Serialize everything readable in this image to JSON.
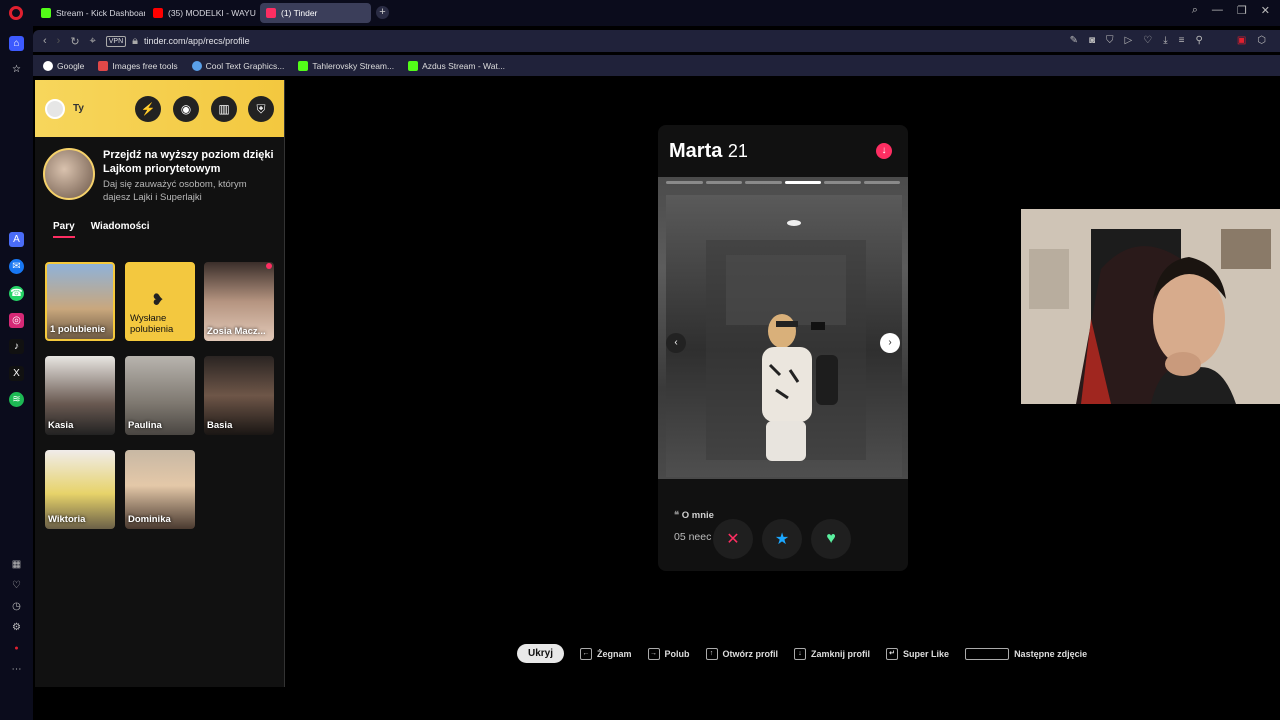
{
  "browser": {
    "tabs": [
      {
        "label": "Stream - Kick Dashboard",
        "favicon_color": "#53fc18"
      },
      {
        "label": "(35) MODELKI - WAYU",
        "favicon_color": "#ff0000"
      },
      {
        "label": "(1) Tinder",
        "favicon_color": "#fd2e62"
      }
    ],
    "url": "tinder.com/app/recs/profile",
    "vpn_label": "VPN",
    "bookmarks": [
      {
        "label": "Google",
        "favicon_color": "#ffffff"
      },
      {
        "label": "Images free tools",
        "favicon_color": "#e04848"
      },
      {
        "label": "Cool Text Graphics...",
        "favicon_color": "#5aa0e8"
      },
      {
        "label": "Tahlerovsky Stream...",
        "favicon_color": "#53fc18"
      },
      {
        "label": "Azdus Stream - Wat...",
        "favicon_color": "#53fc18"
      }
    ]
  },
  "sidebar_panel": {
    "user_name": "Ty",
    "promo_title": "Przejdź na wyższy poziom dzięki Lajkom priorytetowym",
    "promo_subtitle": "Daj się zauważyć osobom, którym dajesz Lajki i Superlajki",
    "tabs": [
      "Pary",
      "Wiadomości"
    ],
    "matches": [
      {
        "name": "1 polubienie",
        "gold": true
      },
      {
        "name": "Wysłane polubienia",
        "gold": true
      },
      {
        "name": "Zosia Macz...",
        "gold": false
      },
      {
        "name": "Kasia",
        "gold": false
      },
      {
        "name": "Paulina",
        "gold": false
      },
      {
        "name": "Basia",
        "gold": false
      },
      {
        "name": "Wiktoria",
        "gold": false
      },
      {
        "name": "Dominika",
        "gold": false
      }
    ]
  },
  "profile": {
    "name": "Marta",
    "age": "21",
    "about_title": "O mnie",
    "about_text": "05 neec",
    "about_text_tail": "e",
    "photo_count": 6,
    "photo_active_index": 4
  },
  "shortcuts": {
    "hide_label": "Ukryj",
    "items": [
      {
        "key": "←",
        "label": "Żegnam"
      },
      {
        "key": "→",
        "label": "Polub"
      },
      {
        "key": "↑",
        "label": "Otwórz profil"
      },
      {
        "key": "↓",
        "label": "Zamknij profil"
      },
      {
        "key": "↵",
        "label": "Super Like"
      },
      {
        "key": "",
        "label": "Następne zdjęcie"
      }
    ]
  },
  "colors": {
    "tinder_pink": "#fd2e62",
    "gold": "#f5c93c",
    "super_blue": "#1ba7ff",
    "like_green": "#5bf0a0"
  }
}
